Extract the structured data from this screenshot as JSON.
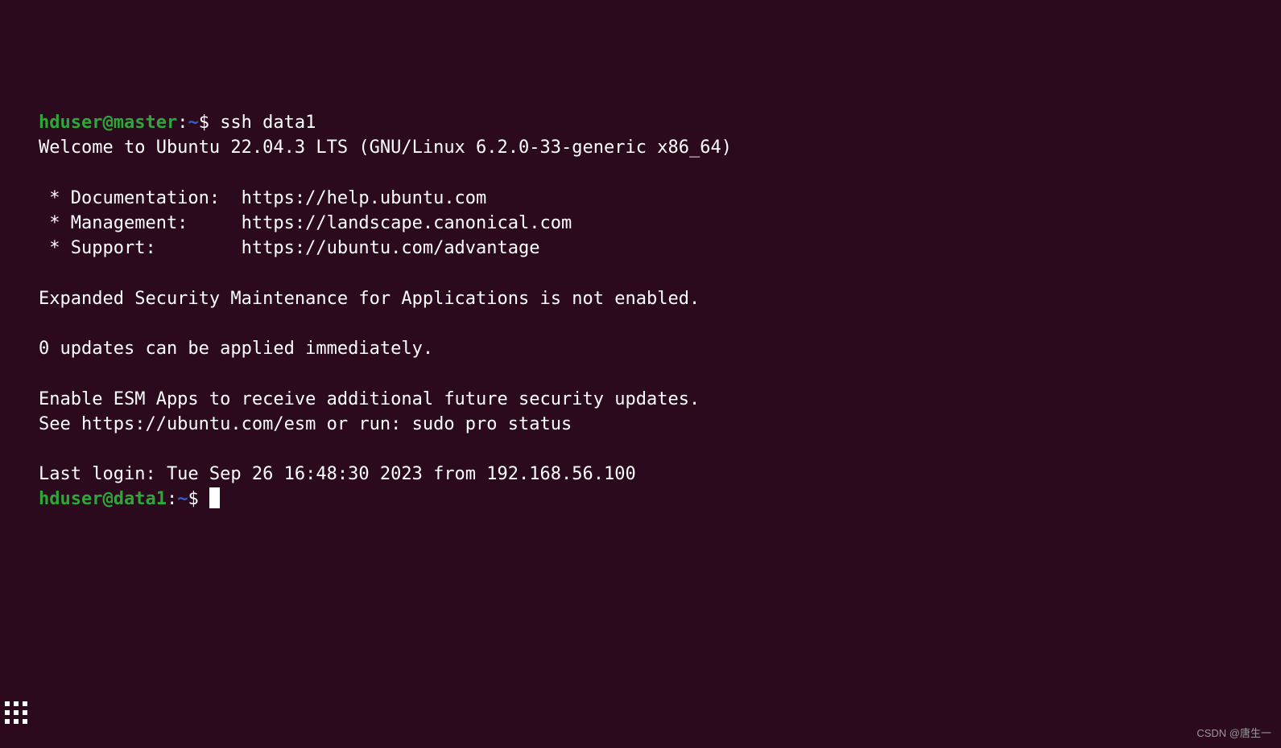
{
  "prompt1": {
    "userhost": "hduser@master",
    "colon": ":",
    "path": "~",
    "dollar": "$ ",
    "command": "ssh data1"
  },
  "motd": {
    "welcome": "Welcome to Ubuntu 22.04.3 LTS (GNU/Linux 6.2.0-33-generic x86_64)",
    "blank1": "",
    "doc": " * Documentation:  https://help.ubuntu.com",
    "mgmt": " * Management:     https://landscape.canonical.com",
    "support": " * Support:        https://ubuntu.com/advantage",
    "blank2": "",
    "esm1": "Expanded Security Maintenance for Applications is not enabled.",
    "blank3": "",
    "updates": "0 updates can be applied immediately.",
    "blank4": "",
    "esm2": "Enable ESM Apps to receive additional future security updates.",
    "esm3": "See https://ubuntu.com/esm or run: sudo pro status",
    "blank5": "",
    "lastlogin": "Last login: Tue Sep 26 16:48:30 2023 from 192.168.56.100"
  },
  "prompt2": {
    "userhost": "hduser@data1",
    "colon": ":",
    "path": "~",
    "dollar": "$ "
  },
  "watermark": "CSDN @唐生一"
}
